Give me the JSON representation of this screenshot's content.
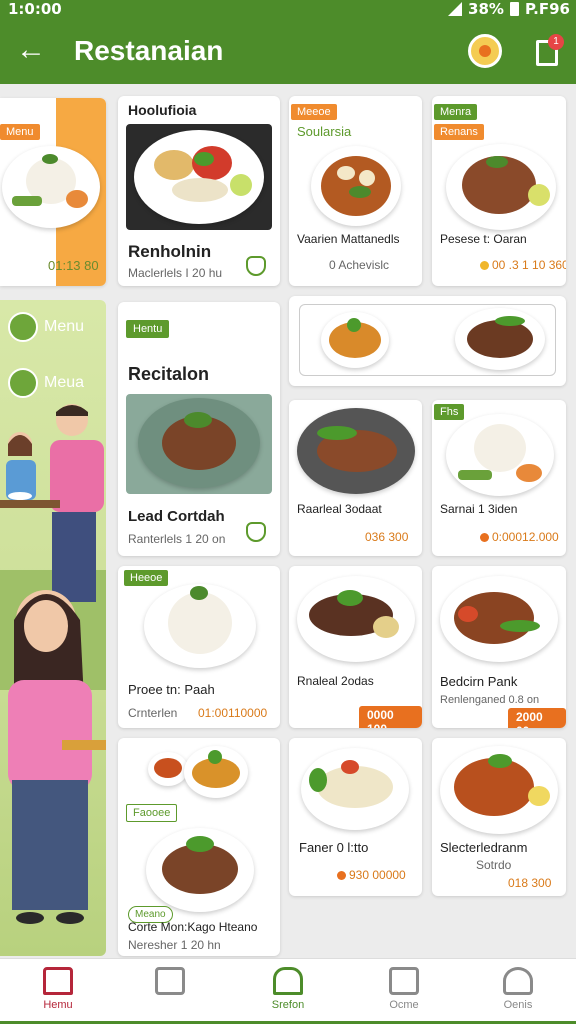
{
  "status_bar": {
    "time": "1:0:00",
    "battery": "38%",
    "extra": "P.F96"
  },
  "app_bar": {
    "title": "Restanaian",
    "back_icon": "arrow-left-icon",
    "settings_icon": "flower-gear-icon",
    "cart_icon": "cart-icon",
    "cart_badge": "1"
  },
  "side": {
    "top_tag": "Menu",
    "top_price": "01:13 80",
    "menu_items": [
      {
        "label": "Menu",
        "icon": "menu-icon"
      },
      {
        "label": "Meua",
        "icon": "list-icon"
      }
    ]
  },
  "cards": {
    "c1": {
      "tag": "Hoolufioia",
      "name": "Renholnin",
      "sub": "Maclerlels I 20 hu"
    },
    "c2": {
      "tag": "Meeoe",
      "tag2": "Soularsia",
      "name": "Vaarien Mattanedls",
      "sub": "0 Achevislc"
    },
    "c3": {
      "tag": "Menra",
      "tag2": "Renans",
      "name": "Pesese t: Oaran",
      "price": "00 .3 1 10 360"
    },
    "c4": {
      "tag": "Hentu",
      "name": "Recitalon",
      "name2": "Lead Cortdah",
      "sub": "Ranterlels 1 20 on"
    },
    "c6": {
      "name": "Raarleal 3odaat",
      "price": "036 300"
    },
    "c7": {
      "tag": "Fhs",
      "name": "Sarnai 1 3iden",
      "price": "0:00012.000"
    },
    "c8": {
      "tag": "Heeoe",
      "name": "Proee tn: Paah",
      "sub": "Crnterlen",
      "price": "01:00110000"
    },
    "c9": {
      "name": "Rnaleal 2odas",
      "badge": "0000 100"
    },
    "c10": {
      "name": "Bedcirn Pank",
      "sub": "Renlenganed 0.8 on",
      "badge": "2000 00"
    },
    "c11": {
      "tag": "Faooee",
      "tag2": "Meano",
      "name": "Corte Mon:Kago Hteano",
      "sub": "Neresher 1 20 hn"
    },
    "c12": {
      "name": "Faner 0 l:tto",
      "price": "930 00000"
    },
    "c13": {
      "name": "Slecterledranm",
      "sub": "Sotrdo",
      "price": "018 300"
    }
  },
  "bottom_nav": [
    {
      "label": "Hemu",
      "icon": "home-icon"
    },
    {
      "label": "",
      "icon": "list-icon"
    },
    {
      "label": "Srefon",
      "icon": "store-icon"
    },
    {
      "label": "Ocme",
      "icon": "bag-icon"
    },
    {
      "label": "Oenis",
      "icon": "profile-icon"
    }
  ],
  "colors": {
    "brand": "#4d8c2a",
    "accent": "#f08b2e",
    "active_nav": "#b5263a"
  }
}
